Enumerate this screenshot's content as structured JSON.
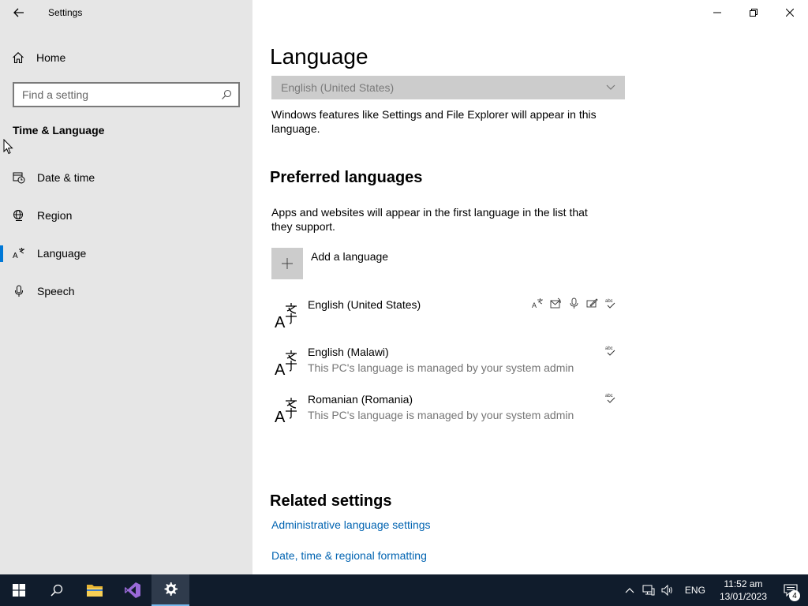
{
  "window": {
    "title": "Settings"
  },
  "sidebar": {
    "home_label": "Home",
    "search_placeholder": "Find a setting",
    "section_title": "Time & Language",
    "items": [
      {
        "label": "Date & time",
        "icon": "calendar-clock-icon"
      },
      {
        "label": "Region",
        "icon": "globe-icon"
      },
      {
        "label": "Language",
        "icon": "language-icon",
        "selected": true
      },
      {
        "label": "Speech",
        "icon": "microphone-icon"
      }
    ]
  },
  "main": {
    "page_title": "Language",
    "display_language": {
      "value": "English (United States)",
      "description": "Windows features like Settings and File Explorer will appear in this language."
    },
    "preferred": {
      "title": "Preferred languages",
      "description": "Apps and websites will appear in the first language in the list that they support.",
      "add_label": "Add a language",
      "languages": [
        {
          "name": "English (United States)",
          "sub": "",
          "features": [
            "display-language-icon",
            "text-to-speech-icon",
            "speech-icon",
            "handwriting-icon",
            "spellcheck-icon"
          ]
        },
        {
          "name": "English (Malawi)",
          "sub": "This PC's language is managed by your system admin",
          "features": [
            "spellcheck-icon"
          ]
        },
        {
          "name": "Romanian (Romania)",
          "sub": "This PC's language is managed by your system admin",
          "features": [
            "spellcheck-icon"
          ]
        }
      ]
    },
    "related": {
      "title": "Related settings",
      "links": [
        "Administrative language settings",
        "Date, time & regional formatting"
      ]
    }
  },
  "taskbar": {
    "language": "ENG",
    "time": "11:52 am",
    "date": "13/01/2023",
    "notification_count": "4"
  },
  "colors": {
    "accent": "#0078d7",
    "link": "#0063b1",
    "sidebar_bg": "#e6e6e6",
    "taskbar_bg": "#101c2c"
  }
}
